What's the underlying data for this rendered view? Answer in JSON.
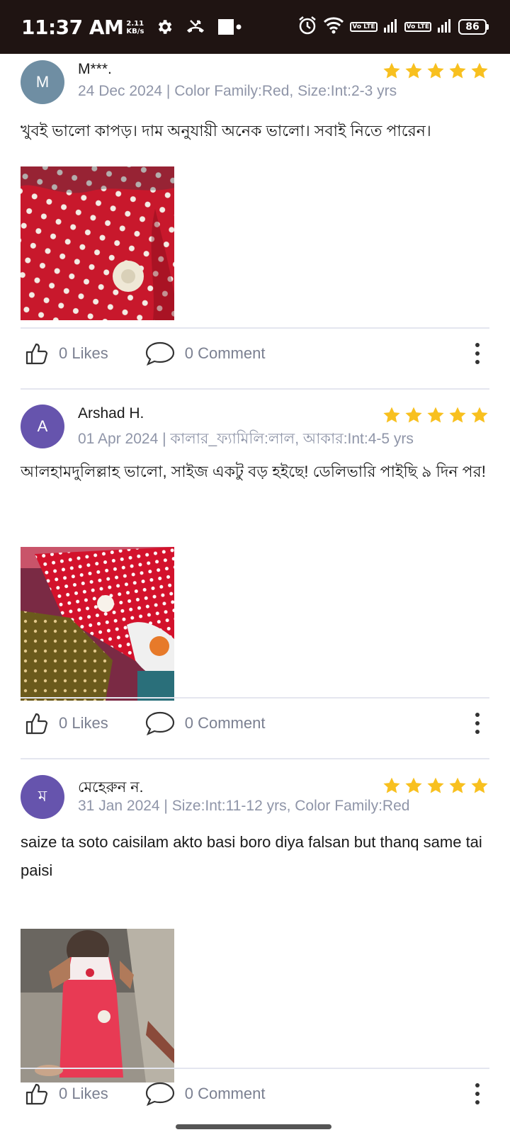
{
  "status_bar": {
    "time": "11:37 AM",
    "speed_value": "2.11",
    "speed_unit": "KB/s",
    "battery": "86",
    "chip1": "Vo LTE",
    "chip2": "Vo LTE"
  },
  "colors": {
    "star": "#f8c01f",
    "avatar_blue": "#6f8ea3",
    "avatar_purple": "#6654ad"
  },
  "reviews": [
    {
      "avatar_letter": "M",
      "name": "M***.",
      "meta": "24 Dec 2024 | Color Family:Red, Size:Int:2-3 yrs",
      "rating": 5,
      "text": "খুবই ভালো কাপড়। দাম অনুযায়ী অনেক ভালো। সবাই নিতে পারেন।",
      "likes": "0 Likes",
      "comments": "0 Comment"
    },
    {
      "avatar_letter": "A",
      "name": "Arshad H.",
      "meta": "01 Apr 2024 | কালার_ফ্যামিলি:লাল, আকার:Int:4-5 yrs",
      "rating": 5,
      "text": "আলহামদুলিল্লাহ ভালো, সাইজ একটু বড় হইছে! ডেলিভারি পাইছি ৯ দিন পর!",
      "likes": "0 Likes",
      "comments": "0 Comment"
    },
    {
      "avatar_letter": "ম",
      "name": "মেহেরুন ন.",
      "meta": "31 Jan 2024 | Size:Int:11-12 yrs, Color Family:Red",
      "rating": 5,
      "text": "saize ta soto caisilam akto basi boro diya falsan but thanq same tai paisi",
      "likes": "0 Likes",
      "comments": "0 Comment"
    }
  ]
}
